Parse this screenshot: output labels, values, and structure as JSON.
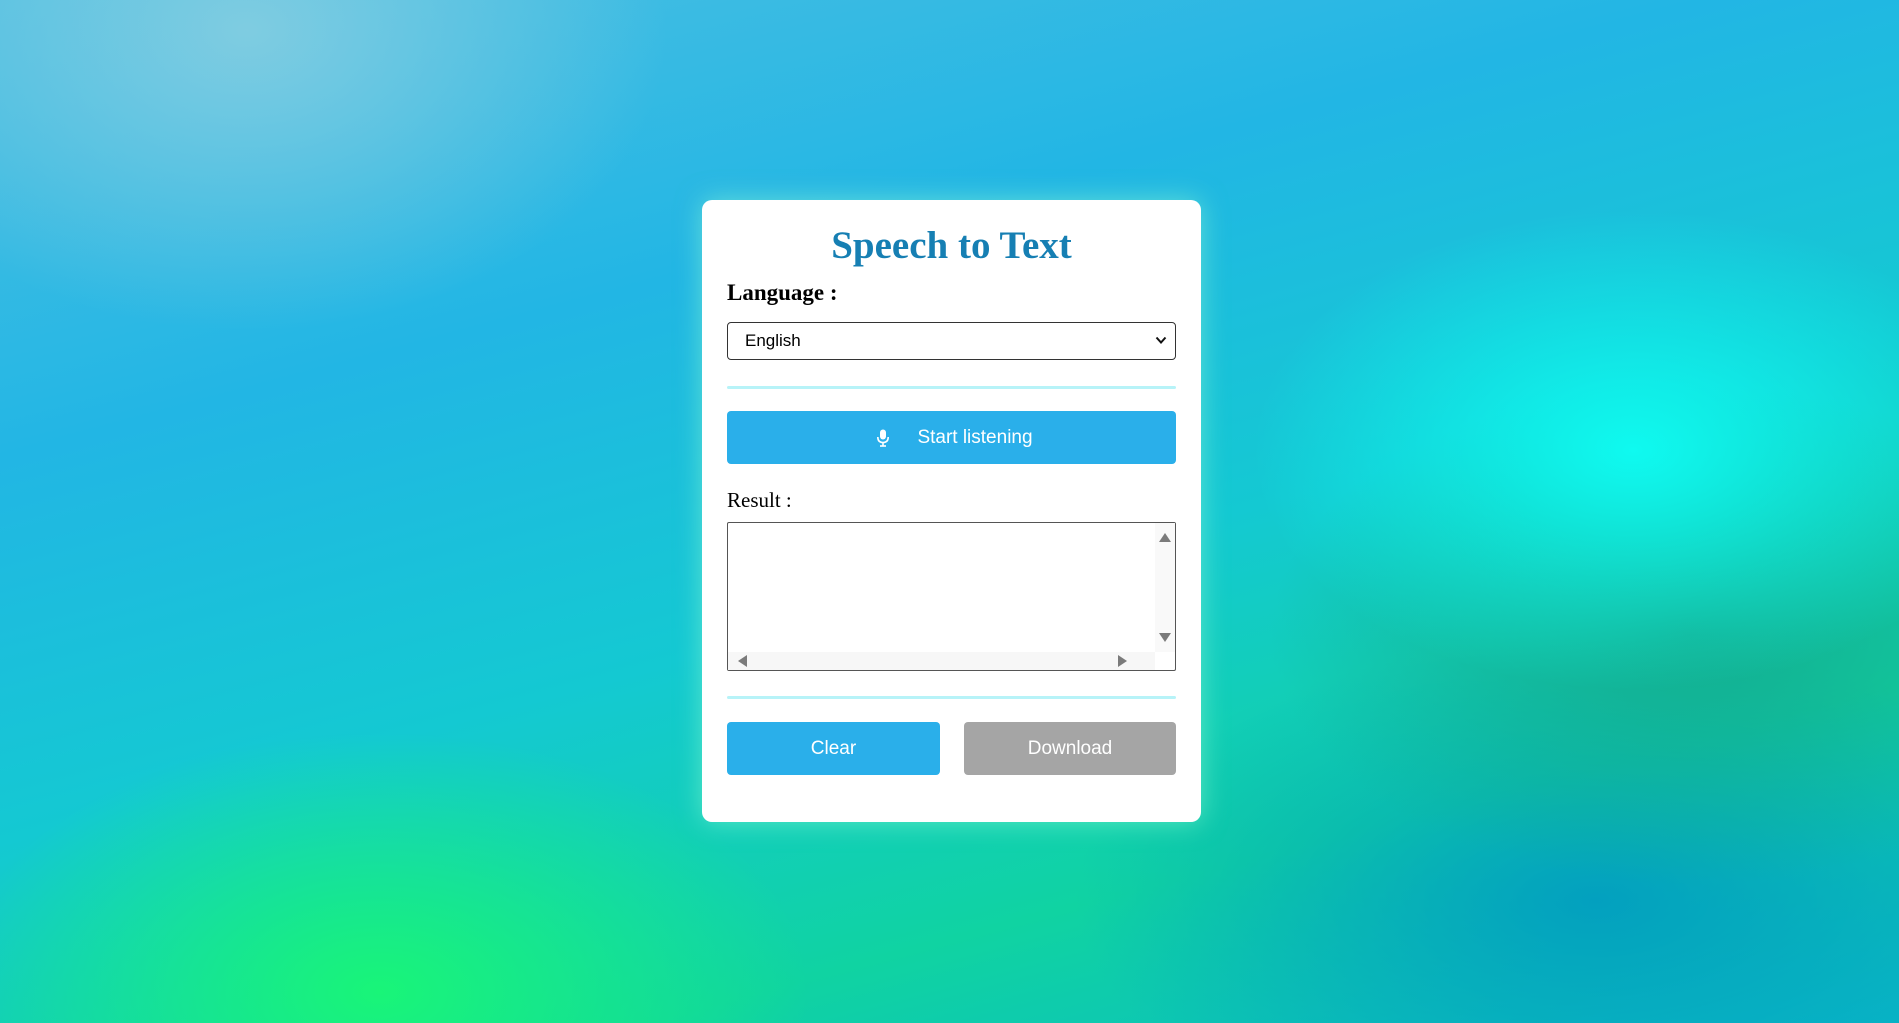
{
  "app": {
    "title": "Speech to Text"
  },
  "language": {
    "label": "Language :",
    "selected": "English"
  },
  "listen_button": {
    "label": "Start listening",
    "icon": "microphone-icon"
  },
  "result": {
    "label": "Result :",
    "value": ""
  },
  "actions": {
    "clear_label": "Clear",
    "download_label": "Download"
  },
  "colors": {
    "title": "#167fb3",
    "primary_button": "#2aafea",
    "disabled_button": "#a5a5a5",
    "divider": "#b7f3f8"
  }
}
